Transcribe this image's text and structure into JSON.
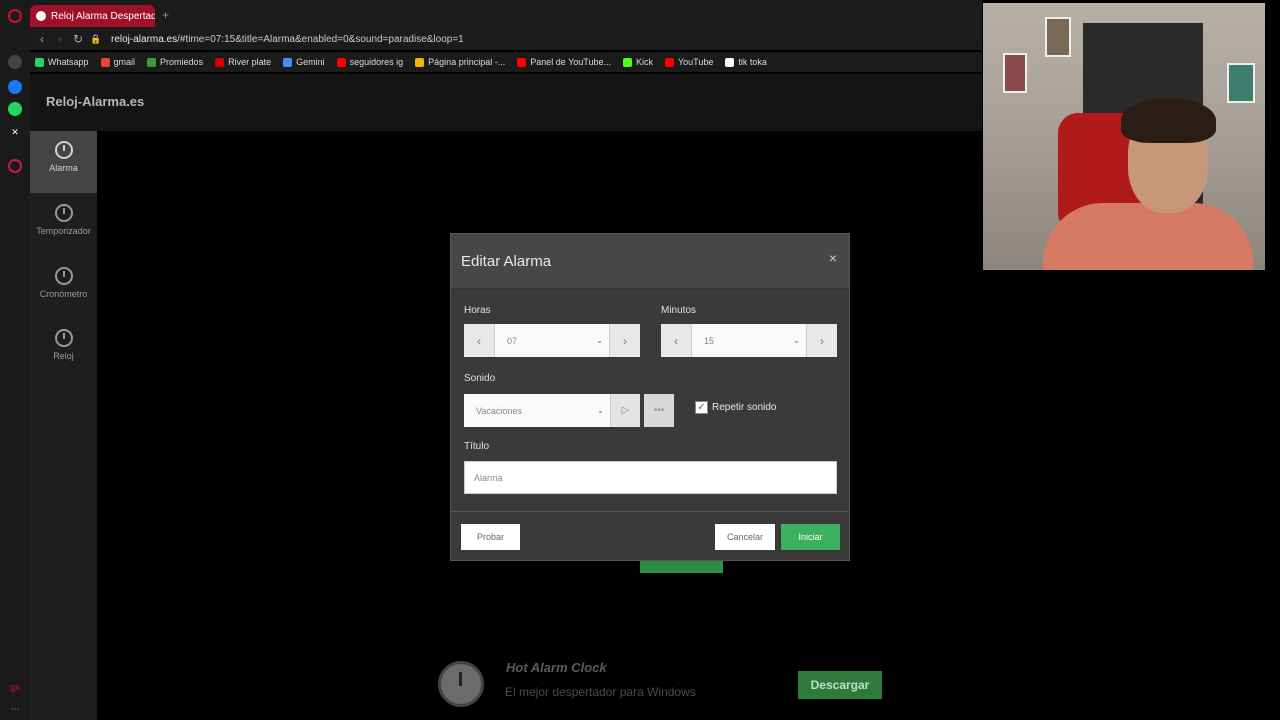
{
  "browser": {
    "tab_title": "Reloj Alarma Despertador",
    "new_tab": "+",
    "url_domain": "reloj-alarma.es",
    "url_rest": "/#time=07:15&title=Alarma&enabled=0&sound=paradise&loop=1",
    "bookmarks": [
      {
        "label": "Whatsapp",
        "color": "#25d366"
      },
      {
        "label": "gmail",
        "color": "#ea4335"
      },
      {
        "label": "Promiedos",
        "color": "#3a9d3a"
      },
      {
        "label": "River plate",
        "color": "#d50000"
      },
      {
        "label": "Gemini",
        "color": "#4a8cf7"
      },
      {
        "label": "seguidores ig",
        "color": "#ff0000"
      },
      {
        "label": "Página principal -...",
        "color": "#f4b400"
      },
      {
        "label": "Panel de YouTube...",
        "color": "#ff0000"
      },
      {
        "label": "Kick",
        "color": "#53fc18"
      },
      {
        "label": "YouTube",
        "color": "#ff0000"
      },
      {
        "label": "tik toka",
        "color": "#ffffff"
      }
    ]
  },
  "site": {
    "brand": "Reloj-Alarma.es",
    "nav": [
      {
        "label": "Alarma",
        "active": true
      },
      {
        "label": "Temporizador",
        "active": false
      },
      {
        "label": "Cronómetro",
        "active": false
      },
      {
        "label": "Reloj",
        "active": false
      }
    ]
  },
  "modal": {
    "title": "Editar Alarma",
    "close": "×",
    "hours_label": "Horas",
    "hours_value": "07",
    "minutes_label": "Minutos",
    "minutes_value": "15",
    "sound_label": "Sonido",
    "sound_value": "Vacaciones",
    "repeat_label": "Repetir sonido",
    "repeat_checked": true,
    "title_label": "Título",
    "title_value": "Alarma",
    "test_button": "Probar",
    "cancel_button": "Cancelar",
    "start_button": "Iniciar"
  },
  "promo": {
    "title": "Hot Alarm Clock",
    "subtitle": "El mejor despertador para Windows",
    "download": "Descargar"
  },
  "colors": {
    "accent_green": "#3cb25e",
    "tab_red": "#a0102a"
  }
}
